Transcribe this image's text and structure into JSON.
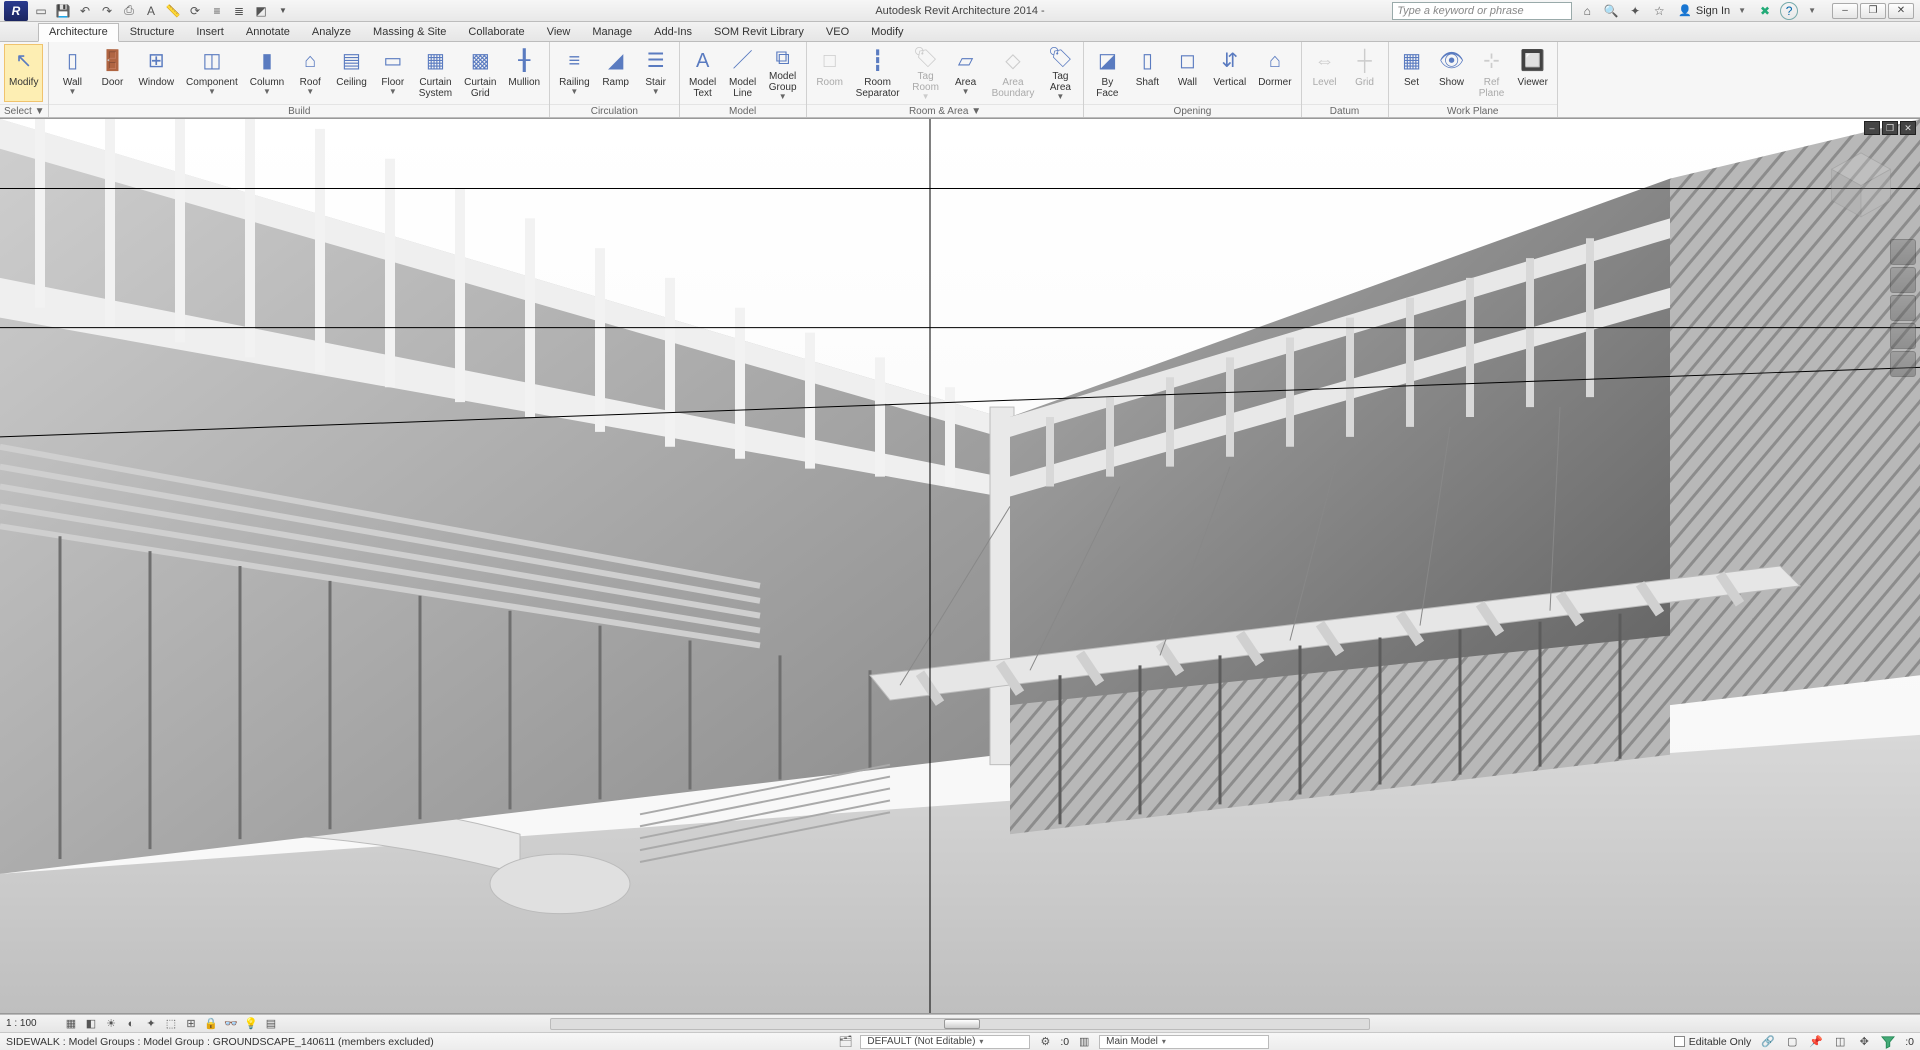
{
  "titlebar": {
    "app_initial": "R",
    "title": "Autodesk Revit Architecture 2014 -",
    "search_placeholder": "Type a keyword or phrase",
    "signin_label": "Sign In",
    "qat_icons": [
      "open-icon",
      "save-icon",
      "undo-icon",
      "redo-icon",
      "print-icon",
      "text-icon",
      "measure-icon",
      "sync-icon",
      "align-icon",
      "thin-lines-icon",
      "close-hidden-icon"
    ],
    "right_icons": [
      "subscription-icon",
      "search-icon",
      "key-icon",
      "favorite-icon"
    ],
    "help_icon": "help-icon",
    "exchange_icon": "exchange-icon",
    "win_min": "–",
    "win_max": "❐",
    "win_close": "✕"
  },
  "menutabs": [
    "Architecture",
    "Structure",
    "Insert",
    "Annotate",
    "Analyze",
    "Massing & Site",
    "Collaborate",
    "View",
    "Manage",
    "Add-Ins",
    "SOM Revit Library",
    "VEO",
    "Modify"
  ],
  "menutabs_active_index": 0,
  "ribbon": {
    "groups": [
      {
        "title": "Select ▼",
        "buttons": [
          {
            "label": "Modify",
            "icon": "cursor-icon",
            "highlighted": true
          }
        ]
      },
      {
        "title": "Build",
        "buttons": [
          {
            "label": "Wall",
            "icon": "wall-icon",
            "dd": true
          },
          {
            "label": "Door",
            "icon": "door-icon"
          },
          {
            "label": "Window",
            "icon": "window-icon"
          },
          {
            "label": "Component",
            "icon": "component-icon",
            "dd": true
          },
          {
            "label": "Column",
            "icon": "column-icon",
            "dd": true
          },
          {
            "label": "Roof",
            "icon": "roof-icon",
            "dd": true
          },
          {
            "label": "Ceiling",
            "icon": "ceiling-icon"
          },
          {
            "label": "Floor",
            "icon": "floor-icon",
            "dd": true
          },
          {
            "label": "Curtain\nSystem",
            "icon": "curtain-system-icon"
          },
          {
            "label": "Curtain\nGrid",
            "icon": "curtain-grid-icon"
          },
          {
            "label": "Mullion",
            "icon": "mullion-icon"
          }
        ]
      },
      {
        "title": "Circulation",
        "buttons": [
          {
            "label": "Railing",
            "icon": "railing-icon",
            "dd": true
          },
          {
            "label": "Ramp",
            "icon": "ramp-icon"
          },
          {
            "label": "Stair",
            "icon": "stair-icon",
            "dd": true
          }
        ]
      },
      {
        "title": "Model",
        "buttons": [
          {
            "label": "Model\nText",
            "icon": "model-text-icon"
          },
          {
            "label": "Model\nLine",
            "icon": "model-line-icon"
          },
          {
            "label": "Model\nGroup",
            "icon": "model-group-icon",
            "dd": true
          }
        ]
      },
      {
        "title": "Room & Area ▼",
        "buttons": [
          {
            "label": "Room",
            "icon": "room-icon",
            "disabled": true
          },
          {
            "label": "Room\nSeparator",
            "icon": "room-separator-icon"
          },
          {
            "label": "Tag\nRoom",
            "icon": "tag-room-icon",
            "dd": true,
            "disabled": true
          },
          {
            "label": "Area",
            "icon": "area-icon",
            "dd": true
          },
          {
            "label": "Area\nBoundary",
            "icon": "area-boundary-icon",
            "disabled": true
          },
          {
            "label": "Tag\nArea",
            "icon": "tag-area-icon",
            "dd": true
          }
        ]
      },
      {
        "title": "Opening",
        "buttons": [
          {
            "label": "By\nFace",
            "icon": "by-face-icon"
          },
          {
            "label": "Shaft",
            "icon": "shaft-icon"
          },
          {
            "label": "Wall",
            "icon": "wall-opening-icon"
          },
          {
            "label": "Vertical",
            "icon": "vertical-icon"
          },
          {
            "label": "Dormer",
            "icon": "dormer-icon"
          }
        ]
      },
      {
        "title": "Datum",
        "buttons": [
          {
            "label": "Level",
            "icon": "level-icon",
            "disabled": true
          },
          {
            "label": "Grid",
            "icon": "grid-icon",
            "disabled": true
          }
        ]
      },
      {
        "title": "Work Plane",
        "buttons": [
          {
            "label": "Set",
            "icon": "set-icon"
          },
          {
            "label": "Show",
            "icon": "show-icon"
          },
          {
            "label": "Ref\nPlane",
            "icon": "ref-plane-icon",
            "disabled": true
          },
          {
            "label": "Viewer",
            "icon": "viewer-icon"
          }
        ]
      }
    ]
  },
  "viewcontrol": {
    "scale": "1 : 100",
    "icons": [
      "detail-level-icon",
      "visual-style-icon",
      "sun-path-icon",
      "shadows-icon",
      "rendering-icon",
      "crop-view-icon",
      "show-crop-icon",
      "lock-3d-icon",
      "temp-hide-icon",
      "reveal-hidden-icon",
      "worksharing-display-icon"
    ]
  },
  "statusbar": {
    "left_text": "SIDEWALK : Model Groups : Model Group : GROUNDSCAPE_140611 (members excluded)",
    "workset_label": "DEFAULT (Not Editable)",
    "design_options_label": "Main Model",
    "editable_only_label": "Editable Only",
    "zero_label": ":0",
    "filter_icon": "filter-icon"
  }
}
